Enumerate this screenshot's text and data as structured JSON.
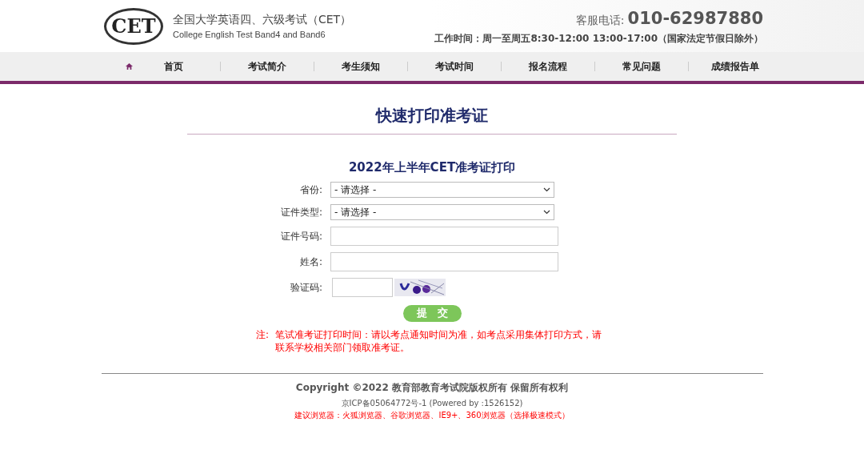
{
  "header": {
    "logo_text": "CET",
    "title_cn": "全国大学英语四、六级考试（CET）",
    "title_en": "College English Test Band4 and Band6",
    "phone_label": "客服电话:",
    "phone": "010-62987880",
    "hours": "工作时间：周一至周五8:30-12:00 13:00-17:00（国家法定节假日除外）"
  },
  "nav": [
    {
      "label": "首页"
    },
    {
      "label": "考试简介"
    },
    {
      "label": "考生须知"
    },
    {
      "label": "考试时间"
    },
    {
      "label": "报名流程"
    },
    {
      "label": "常见问题"
    },
    {
      "label": "成绩报告单"
    }
  ],
  "page_title": "快速打印准考证",
  "form": {
    "title": "2022年上半年CET准考证打印",
    "fields": [
      {
        "kind": "select",
        "label": "省份:",
        "value": "- 请选择 -"
      },
      {
        "kind": "select",
        "label": "证件类型:",
        "value": "- 请选择 -"
      },
      {
        "kind": "input",
        "label": "证件号码:"
      },
      {
        "kind": "input",
        "label": "姓名:"
      },
      {
        "kind": "captcha",
        "label": "验证码:"
      }
    ],
    "submit": "提　交",
    "note_label": "注:",
    "note": "笔试准考证打印时间：请以考点通知时间为准，如考点采用集体打印方式，请联系学校相关部门领取准考证。"
  },
  "footer": {
    "copyright": "Copyright ©2022 教育部教育考试院版权所有 保留所有权利",
    "icp": "京ICP备05064772号-1 (Powered by :1526152)",
    "browsers": "建议浏览器：火狐浏览器、谷歌浏览器、IE9+、360浏览器（选择极速模式）"
  }
}
